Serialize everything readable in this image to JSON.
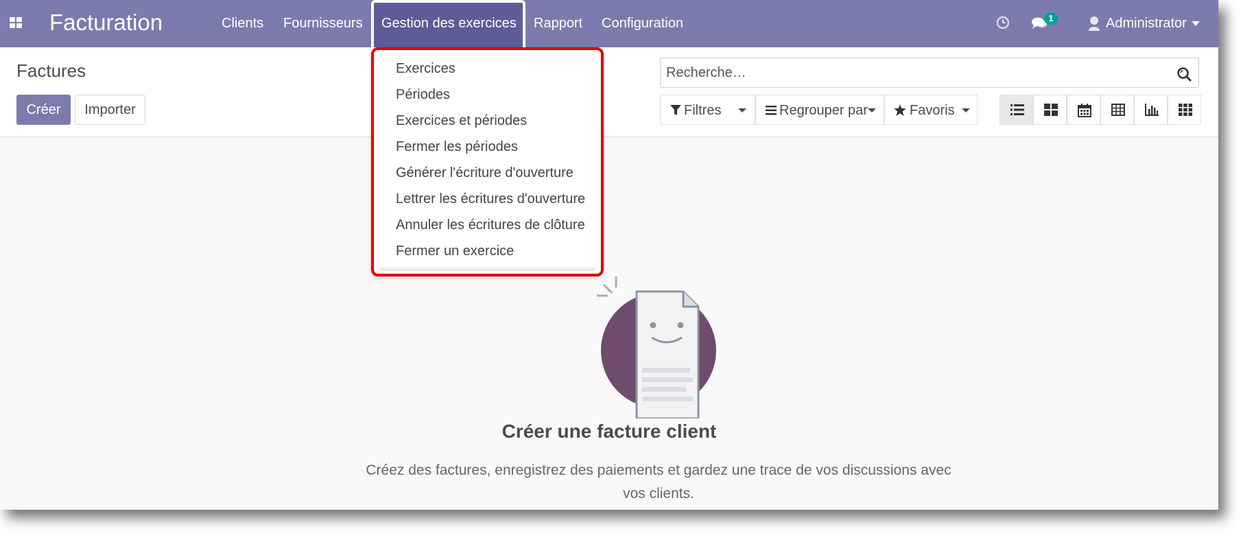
{
  "navbar": {
    "brand": "Facturation",
    "menu": [
      "Clients",
      "Fournisseurs",
      "Gestion des exercices",
      "Rapport",
      "Configuration"
    ],
    "active_menu_index": 2,
    "messages_badge": "1",
    "user": "Administrator",
    "icons": {
      "apps": "apps-grid-icon",
      "activity": "clock-icon",
      "messages": "chat-icon",
      "user": "user-avatar-icon"
    }
  },
  "dropdown": {
    "items": [
      "Exercices",
      "Périodes",
      "Exercices et périodes",
      "Fermer les périodes",
      "Générer l'écriture d'ouverture",
      "Lettrer les écritures d'ouverture",
      "Annuler les écritures de clôture",
      "Fermer un exercice"
    ]
  },
  "control_panel": {
    "title": "Factures",
    "create_label": "Créer",
    "import_label": "Importer",
    "search_placeholder": "Recherche…",
    "filters_label": "Filtres",
    "groupby_label": "Regrouper par",
    "favorites_label": "Favoris",
    "views": [
      "list",
      "kanban",
      "calendar",
      "pivot",
      "graph",
      "grid"
    ],
    "active_view": "list"
  },
  "empty_state": {
    "title": "Créer une facture client",
    "text_line1": "Créez des factures, enregistrez des paiements et gardez une trace de vos discussions avec",
    "text_line2": "vos clients."
  },
  "colors": {
    "navbar": "#7c7bad",
    "navbar_active": "#5e5c96",
    "primary_button": "#7c7bad",
    "highlight_border": "#e00000",
    "badge": "#00a09d",
    "illustration_circle": "#6f4b6d"
  }
}
